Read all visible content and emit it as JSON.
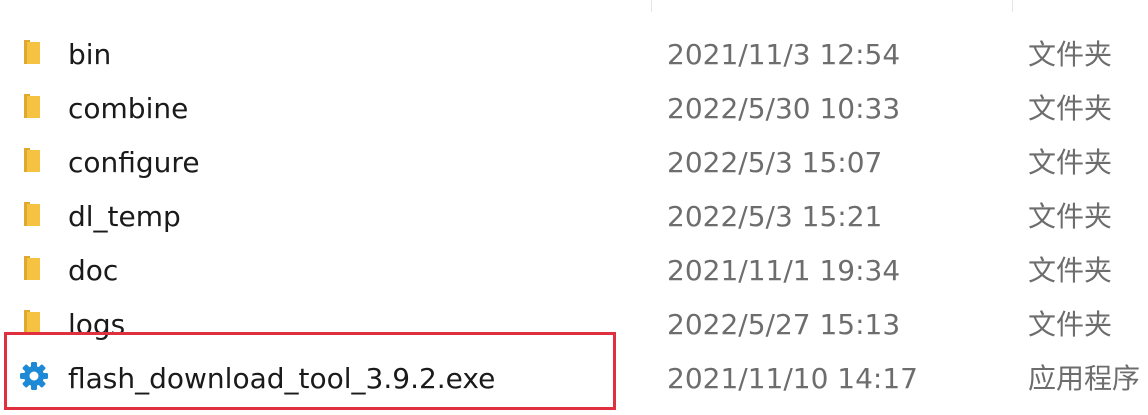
{
  "files": [
    {
      "name": "bin",
      "modified": "2021/11/3 12:54",
      "type": "文件夹",
      "icon": "folder-icon"
    },
    {
      "name": "combine",
      "modified": "2022/5/30 10:33",
      "type": "文件夹",
      "icon": "folder-icon"
    },
    {
      "name": "configure",
      "modified": "2022/5/3 15:07",
      "type": "文件夹",
      "icon": "folder-icon"
    },
    {
      "name": "dl_temp",
      "modified": "2022/5/3 15:21",
      "type": "文件夹",
      "icon": "folder-icon"
    },
    {
      "name": "doc",
      "modified": "2021/11/1 19:34",
      "type": "文件夹",
      "icon": "folder-icon"
    },
    {
      "name": "logs",
      "modified": "2022/5/27 15:13",
      "type": "文件夹",
      "icon": "folder-icon"
    },
    {
      "name": "flash_download_tool_3.9.2.exe",
      "modified": "2021/11/10 14:17",
      "type": "应用程序",
      "icon": "gear-icon"
    }
  ],
  "colors": {
    "folder": "#f5c242",
    "folder_dark": "#e0a82e",
    "gear": "#1e8ad6",
    "highlight": "#e03040"
  }
}
